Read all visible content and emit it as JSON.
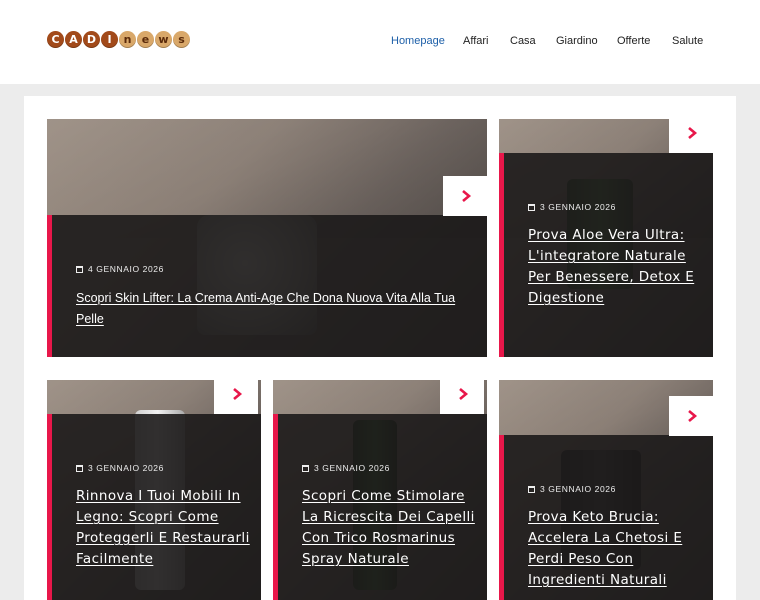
{
  "logo": {
    "letters": [
      "C",
      "A",
      "D",
      "I",
      "n",
      "e",
      "w",
      "s"
    ],
    "icon": "cadinews-logo"
  },
  "nav": [
    {
      "label": "Homepage",
      "active": true
    },
    {
      "label": "Affari"
    },
    {
      "label": "Casa"
    },
    {
      "label": "Giardino"
    },
    {
      "label": "Offerte"
    },
    {
      "label": "Salute"
    }
  ],
  "colors": {
    "accent": "#e8174a",
    "nav_active": "#1d5fa8",
    "logo": "#a24a1a"
  },
  "cards": [
    {
      "date": "4 GENNAIO 2026",
      "title": "Scopri Skin Lifter: La Crema Anti-Age Che Dona Nuova Vita Alla Tua Pelle",
      "icon": "chevron-right-icon"
    },
    {
      "date": "3 GENNAIO 2026",
      "title": "Prova Aloe Vera Ultra: L'integratore Naturale Per Benessere, Detox E Digestione",
      "icon": "chevron-right-icon"
    },
    {
      "date": "3 GENNAIO 2026",
      "title": "Rinnova I Tuoi Mobili In Legno: Scopri Come Proteggerli E Restaurarli Facilmente",
      "icon": "chevron-right-icon"
    },
    {
      "date": "3 GENNAIO 2026",
      "title": "Scopri Come Stimolare La Ricrescita Dei Capelli Con Trico Rosmarinus Spray Naturale",
      "icon": "chevron-right-icon"
    },
    {
      "date": "3 GENNAIO 2026",
      "title": "Prova Keto Brucia: Accelera La Chetosi E Perdi Peso Con Ingredienti Naturali",
      "icon": "chevron-right-icon"
    }
  ]
}
